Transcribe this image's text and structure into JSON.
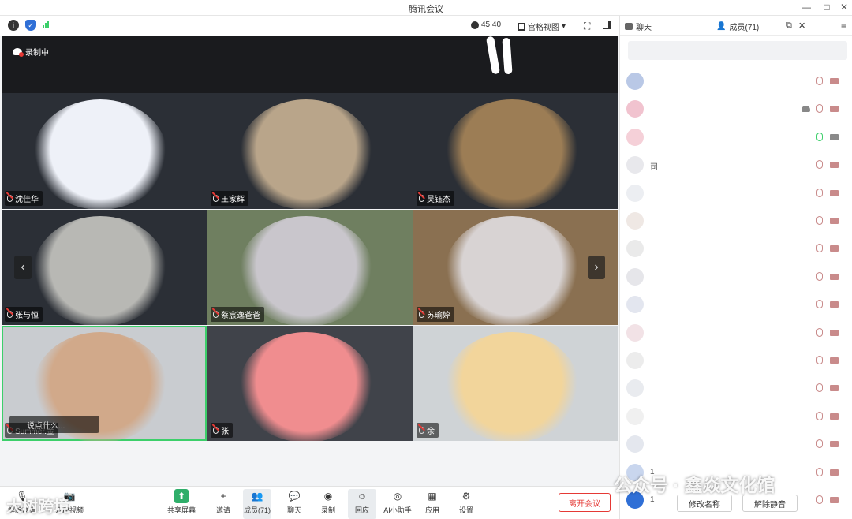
{
  "window": {
    "title": "腾讯会议",
    "controls": [
      "—",
      "□",
      "✕"
    ]
  },
  "topbar": {
    "timer": "45:40",
    "view_mode": "宫格视图",
    "chat_tab": "聊天",
    "members_tab": "成员(71)"
  },
  "recording": {
    "label": "录制中"
  },
  "tiles": [
    {
      "name": "沈佳华",
      "colors": [
        "#2b2f36",
        "#eef1f8"
      ]
    },
    {
      "name": "王家辉",
      "colors": [
        "#2b2f36",
        "#b9a58a"
      ]
    },
    {
      "name": "吴钰杰",
      "colors": [
        "#2b2f36",
        "#9c7d55"
      ]
    },
    {
      "name": "张与恒",
      "colors": [
        "#2b2f36",
        "#b8b8b4"
      ]
    },
    {
      "name": "蔡宸逸爸爸",
      "colors": [
        "#6f7f60",
        "#c9c6cc"
      ]
    },
    {
      "name": "苏瑜婷",
      "colors": [
        "#8a7051",
        "#d8d3d3"
      ]
    },
    {
      "name": "Summer.金",
      "colors": [
        "#c9ccd0",
        "#d1a98a"
      ]
    },
    {
      "name": "张",
      "colors": [
        "#40434a",
        "#f08d8f"
      ]
    },
    {
      "name": "余",
      "colors": [
        "#cfd3d6",
        "#f2d59b"
      ]
    }
  ],
  "chat_bubble": {
    "text": "说点什么..."
  },
  "toolbar": {
    "items": [
      {
        "label": "解除静音",
        "icon": "mic-off-icon"
      },
      {
        "label": "开启视频",
        "icon": "camera-off-icon"
      },
      {
        "label": "共享屏幕",
        "icon": "share-screen-icon"
      },
      {
        "label": "邀请",
        "icon": "invite-icon"
      },
      {
        "label": "成员(71)",
        "icon": "members-icon"
      },
      {
        "label": "聊天",
        "icon": "chat-icon"
      },
      {
        "label": "录制",
        "icon": "record-icon"
      },
      {
        "label": "回应",
        "icon": "reaction-icon"
      },
      {
        "label": "AI小助手",
        "icon": "ai-assistant-icon"
      },
      {
        "label": "应用",
        "icon": "apps-icon"
      },
      {
        "label": "设置",
        "icon": "settings-icon"
      }
    ],
    "leave_label": "离开会议"
  },
  "sidebar": {
    "members": [
      {
        "name": "",
        "avatar": "#b9c8e6",
        "mic": "off"
      },
      {
        "name": "",
        "avatar": "#f1c3cf",
        "mic": "off",
        "recording": true
      },
      {
        "name": "",
        "avatar": "#f5d0d8",
        "mic": "on"
      },
      {
        "name": "司",
        "avatar": "#e8e8ec",
        "mic": "off"
      },
      {
        "name": "",
        "avatar": "#eceef2",
        "mic": "off"
      },
      {
        "name": "",
        "avatar": "#efe8e4",
        "mic": "off"
      },
      {
        "name": "",
        "avatar": "#eaeaea",
        "mic": "off"
      },
      {
        "name": "",
        "avatar": "#e6e6ea",
        "mic": "off"
      },
      {
        "name": "",
        "avatar": "#e3e6ef",
        "mic": "off"
      },
      {
        "name": "",
        "avatar": "#f2e2e6",
        "mic": "off"
      },
      {
        "name": "",
        "avatar": "#ececec",
        "mic": "off"
      },
      {
        "name": "",
        "avatar": "#e9ebef",
        "mic": "off"
      },
      {
        "name": "",
        "avatar": "#f0f0f0",
        "mic": "off"
      },
      {
        "name": "",
        "avatar": "#e4e7ee",
        "mic": "off"
      },
      {
        "name": "1",
        "avatar": "#c9d6ee",
        "mic": "off"
      },
      {
        "name": "1",
        "avatar": "#2f6fd6",
        "mic": "off"
      }
    ],
    "rename_label": "修改名称",
    "unmute_label": "解除静音"
  },
  "watermarks": {
    "left": "大树跨境",
    "right": "公众号 · 鑫焱文化馆"
  },
  "colors": {
    "accent": "#2f6fd6",
    "danger": "#e53935",
    "active": "#3ccf6a"
  }
}
